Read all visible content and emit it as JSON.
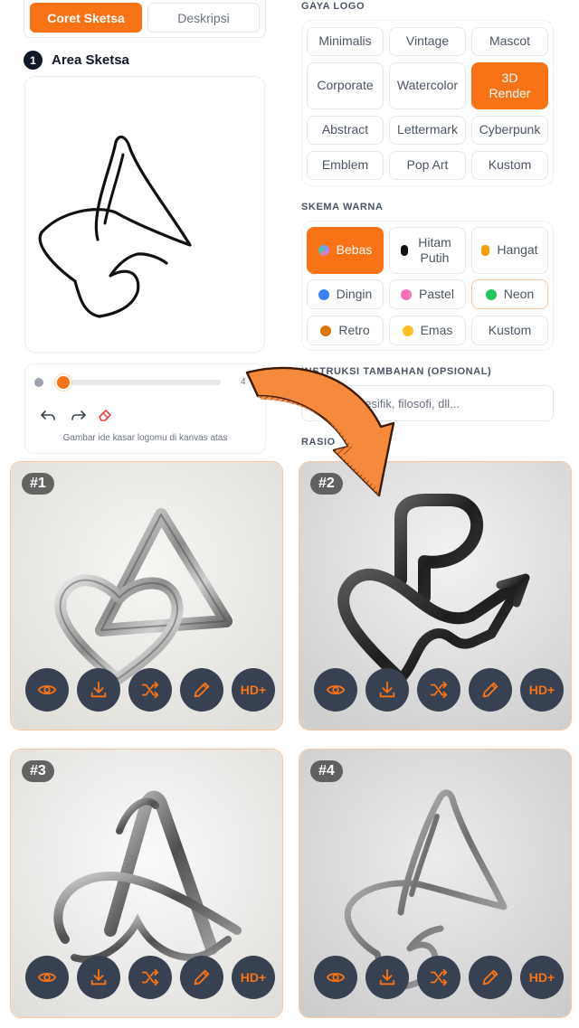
{
  "tabs": [
    {
      "label": "Coret Sketsa",
      "active": true
    },
    {
      "label": "Deskripsi",
      "active": false
    }
  ],
  "sketch": {
    "step_number": "1",
    "title": "Area Sketsa",
    "brush_size": "4",
    "hint": "Gambar ide kasar logomu di kanvas atas"
  },
  "logo_style": {
    "title": "GAYA LOGO",
    "options": [
      {
        "label": "Minimalis",
        "active": false
      },
      {
        "label": "Vintage",
        "active": false
      },
      {
        "label": "Mascot",
        "active": false
      },
      {
        "label": "Corporate",
        "active": false
      },
      {
        "label": "Watercolor",
        "active": false
      },
      {
        "label": "3D Render",
        "active": true
      },
      {
        "label": "Abstract",
        "active": false
      },
      {
        "label": "Lettermark",
        "active": false
      },
      {
        "label": "Cyberpunk",
        "active": false
      },
      {
        "label": "Emblem",
        "active": false
      },
      {
        "label": "Pop Art",
        "active": false
      },
      {
        "label": "Kustom",
        "active": false
      }
    ]
  },
  "color_scheme": {
    "title": "SKEMA WARNA",
    "options": [
      {
        "label": "Bebas",
        "color": "#a78bfa",
        "active": true
      },
      {
        "label": "Hitam Putih",
        "color": "#111111",
        "active": false
      },
      {
        "label": "Hangat",
        "color": "#f59e0b",
        "active": false
      },
      {
        "label": "Dingin",
        "color": "#3b82f6",
        "active": false
      },
      {
        "label": "Pastel",
        "color": "#f472b6",
        "active": false
      },
      {
        "label": "Neon",
        "color": "#22c55e",
        "active": false
      },
      {
        "label": "Retro",
        "color": "#d97706",
        "active": false
      },
      {
        "label": "Emas",
        "color": "#fbbf24",
        "active": false
      },
      {
        "label": "Kustom",
        "color": "",
        "active": false
      }
    ]
  },
  "instructions": {
    "title": "INSTRUKSI TAMBAHAN (OPSIONAL)",
    "placeholder": "pesifik, filosofi, dll..."
  },
  "ratio": {
    "title": "RASIO"
  },
  "results": [
    {
      "badge": "#1"
    },
    {
      "badge": "#2"
    },
    {
      "badge": "#3"
    },
    {
      "badge": "#4"
    }
  ],
  "result_actions": [
    {
      "name": "view-button",
      "icon": "eye-icon",
      "label": ""
    },
    {
      "name": "download-button",
      "icon": "download-icon",
      "label": ""
    },
    {
      "name": "shuffle-button",
      "icon": "shuffle-icon",
      "label": ""
    },
    {
      "name": "edit-button",
      "icon": "pencil-icon",
      "label": ""
    },
    {
      "name": "hd-upscale-button",
      "icon": "",
      "label": "HD+"
    }
  ],
  "colors": {
    "accent": "#f97316",
    "action_bg": "#374151"
  }
}
